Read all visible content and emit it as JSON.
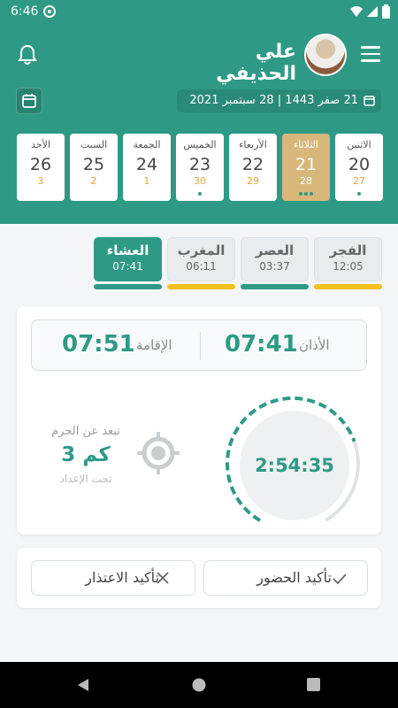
{
  "status_bar": {
    "time": "6:46"
  },
  "header": {
    "user_name": "علي الحذيفي",
    "date_text": "21 صفر 1443  |  28 سبتمبر 2021"
  },
  "days": [
    {
      "name": "الاثنين",
      "num": "20",
      "hijri": "27",
      "active": false,
      "dots": 1
    },
    {
      "name": "الثلاثاء",
      "num": "21",
      "hijri": "28",
      "active": true,
      "dots": 3
    },
    {
      "name": "الأربعاء",
      "num": "22",
      "hijri": "29",
      "active": false,
      "dots": 0
    },
    {
      "name": "الخميس",
      "num": "23",
      "hijri": "30",
      "active": false,
      "dots": 1
    },
    {
      "name": "الجمعة",
      "num": "24",
      "hijri": "1",
      "active": false,
      "dots": 0
    },
    {
      "name": "السبت",
      "num": "25",
      "hijri": "2",
      "active": false,
      "dots": 0
    },
    {
      "name": "الأحد",
      "num": "26",
      "hijri": "3",
      "active": false,
      "dots": 0
    }
  ],
  "prayers": [
    {
      "name": "الفجر",
      "time": "12:05",
      "active": false,
      "bar_color": "#f2c01e"
    },
    {
      "name": "العصر",
      "time": "03:37",
      "active": false,
      "bar_color": "#2e9a86"
    },
    {
      "name": "المغرب",
      "time": "06:11",
      "active": false,
      "bar_color": "#f2c01e"
    },
    {
      "name": "العشاء",
      "time": "07:41",
      "active": true,
      "bar_color": "#2e9a86"
    }
  ],
  "times": {
    "adhan_label": "الأذان",
    "adhan_time": "07:41",
    "iqama_label": "الإقامة",
    "iqama_time": "07:51"
  },
  "distance": {
    "title": "تبعد عن الحرم",
    "value": "3 كم",
    "subtitle": "تحت الإعداد"
  },
  "countdown": "2:54:35",
  "actions": {
    "confirm_label": "تأكيد الحضور",
    "excuse_label": "تأكيد الاعتذار"
  },
  "colors": {
    "primary": "#2e9a86",
    "gold": "#d8b77a",
    "yellow": "#f2c01e"
  }
}
